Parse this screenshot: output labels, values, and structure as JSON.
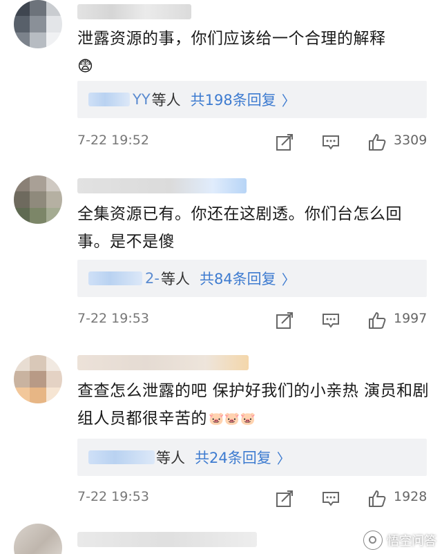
{
  "comments": [
    {
      "username": "",
      "text": "泄露资源的事，你们应该给一个合理的解释",
      "emoji": "😨",
      "reply_names": "YY",
      "reply_suffix": "等人",
      "reply_count": "共198条回复",
      "time": "7-22 19:52",
      "likes": "3309"
    },
    {
      "username": "",
      "text": "全集资源已有。你还在这剧透。你们台怎么回事。是不是傻",
      "emoji": "",
      "reply_names": "2-",
      "reply_suffix": "等人",
      "reply_count": "共84条回复",
      "time": "7-22 19:53",
      "likes": "1997"
    },
    {
      "username": "",
      "text": "查查怎么泄露的吧 保护好我们的小亲热 演员和剧组人员都很辛苦的",
      "emoji": "🐷🐷🐷",
      "reply_names": "",
      "reply_suffix": "等人",
      "reply_count": "共24条回复",
      "time": "7-22 19:53",
      "likes": "1928"
    }
  ],
  "icons": {
    "share": "share-icon",
    "comment": "comment-icon",
    "like": "thumbs-up-icon",
    "chevron": "chevron-right-icon"
  },
  "colors": {
    "link_blue": "#3d7bd0",
    "reply_bg": "#f1f2f4",
    "meta_gray": "#777777"
  },
  "watermark": {
    "text": "悟空问答"
  },
  "chevron_glyph": "〉"
}
